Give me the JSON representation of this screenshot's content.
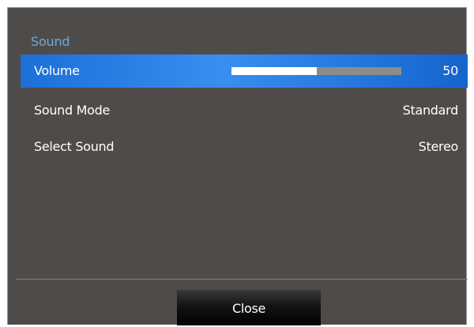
{
  "menu": {
    "title": "Sound",
    "items": [
      {
        "label": "Volume",
        "value": "50",
        "selected": true,
        "level_percent": 50
      },
      {
        "label": "Sound Mode",
        "value": "Standard"
      },
      {
        "label": "Select Sound",
        "value": "Stereo"
      }
    ]
  },
  "footer": {
    "close_label": "Close"
  },
  "colors": {
    "panel_background": "#4f4b48",
    "title_accent": "#6aa9dc",
    "selection_highlight": "#2a7ee6"
  }
}
